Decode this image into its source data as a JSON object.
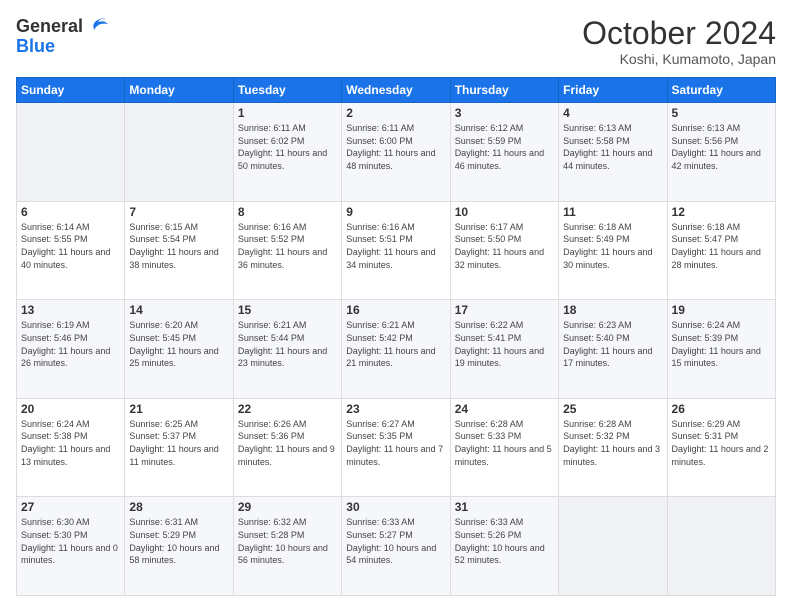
{
  "header": {
    "logo_line1": "General",
    "logo_line2": "Blue",
    "month_title": "October 2024",
    "location": "Koshi, Kumamoto, Japan"
  },
  "days_of_week": [
    "Sunday",
    "Monday",
    "Tuesday",
    "Wednesday",
    "Thursday",
    "Friday",
    "Saturday"
  ],
  "weeks": [
    [
      {
        "day": "",
        "content": ""
      },
      {
        "day": "",
        "content": ""
      },
      {
        "day": "1",
        "content": "Sunrise: 6:11 AM\nSunset: 6:02 PM\nDaylight: 11 hours and 50 minutes."
      },
      {
        "day": "2",
        "content": "Sunrise: 6:11 AM\nSunset: 6:00 PM\nDaylight: 11 hours and 48 minutes."
      },
      {
        "day": "3",
        "content": "Sunrise: 6:12 AM\nSunset: 5:59 PM\nDaylight: 11 hours and 46 minutes."
      },
      {
        "day": "4",
        "content": "Sunrise: 6:13 AM\nSunset: 5:58 PM\nDaylight: 11 hours and 44 minutes."
      },
      {
        "day": "5",
        "content": "Sunrise: 6:13 AM\nSunset: 5:56 PM\nDaylight: 11 hours and 42 minutes."
      }
    ],
    [
      {
        "day": "6",
        "content": "Sunrise: 6:14 AM\nSunset: 5:55 PM\nDaylight: 11 hours and 40 minutes."
      },
      {
        "day": "7",
        "content": "Sunrise: 6:15 AM\nSunset: 5:54 PM\nDaylight: 11 hours and 38 minutes."
      },
      {
        "day": "8",
        "content": "Sunrise: 6:16 AM\nSunset: 5:52 PM\nDaylight: 11 hours and 36 minutes."
      },
      {
        "day": "9",
        "content": "Sunrise: 6:16 AM\nSunset: 5:51 PM\nDaylight: 11 hours and 34 minutes."
      },
      {
        "day": "10",
        "content": "Sunrise: 6:17 AM\nSunset: 5:50 PM\nDaylight: 11 hours and 32 minutes."
      },
      {
        "day": "11",
        "content": "Sunrise: 6:18 AM\nSunset: 5:49 PM\nDaylight: 11 hours and 30 minutes."
      },
      {
        "day": "12",
        "content": "Sunrise: 6:18 AM\nSunset: 5:47 PM\nDaylight: 11 hours and 28 minutes."
      }
    ],
    [
      {
        "day": "13",
        "content": "Sunrise: 6:19 AM\nSunset: 5:46 PM\nDaylight: 11 hours and 26 minutes."
      },
      {
        "day": "14",
        "content": "Sunrise: 6:20 AM\nSunset: 5:45 PM\nDaylight: 11 hours and 25 minutes."
      },
      {
        "day": "15",
        "content": "Sunrise: 6:21 AM\nSunset: 5:44 PM\nDaylight: 11 hours and 23 minutes."
      },
      {
        "day": "16",
        "content": "Sunrise: 6:21 AM\nSunset: 5:42 PM\nDaylight: 11 hours and 21 minutes."
      },
      {
        "day": "17",
        "content": "Sunrise: 6:22 AM\nSunset: 5:41 PM\nDaylight: 11 hours and 19 minutes."
      },
      {
        "day": "18",
        "content": "Sunrise: 6:23 AM\nSunset: 5:40 PM\nDaylight: 11 hours and 17 minutes."
      },
      {
        "day": "19",
        "content": "Sunrise: 6:24 AM\nSunset: 5:39 PM\nDaylight: 11 hours and 15 minutes."
      }
    ],
    [
      {
        "day": "20",
        "content": "Sunrise: 6:24 AM\nSunset: 5:38 PM\nDaylight: 11 hours and 13 minutes."
      },
      {
        "day": "21",
        "content": "Sunrise: 6:25 AM\nSunset: 5:37 PM\nDaylight: 11 hours and 11 minutes."
      },
      {
        "day": "22",
        "content": "Sunrise: 6:26 AM\nSunset: 5:36 PM\nDaylight: 11 hours and 9 minutes."
      },
      {
        "day": "23",
        "content": "Sunrise: 6:27 AM\nSunset: 5:35 PM\nDaylight: 11 hours and 7 minutes."
      },
      {
        "day": "24",
        "content": "Sunrise: 6:28 AM\nSunset: 5:33 PM\nDaylight: 11 hours and 5 minutes."
      },
      {
        "day": "25",
        "content": "Sunrise: 6:28 AM\nSunset: 5:32 PM\nDaylight: 11 hours and 3 minutes."
      },
      {
        "day": "26",
        "content": "Sunrise: 6:29 AM\nSunset: 5:31 PM\nDaylight: 11 hours and 2 minutes."
      }
    ],
    [
      {
        "day": "27",
        "content": "Sunrise: 6:30 AM\nSunset: 5:30 PM\nDaylight: 11 hours and 0 minutes."
      },
      {
        "day": "28",
        "content": "Sunrise: 6:31 AM\nSunset: 5:29 PM\nDaylight: 10 hours and 58 minutes."
      },
      {
        "day": "29",
        "content": "Sunrise: 6:32 AM\nSunset: 5:28 PM\nDaylight: 10 hours and 56 minutes."
      },
      {
        "day": "30",
        "content": "Sunrise: 6:33 AM\nSunset: 5:27 PM\nDaylight: 10 hours and 54 minutes."
      },
      {
        "day": "31",
        "content": "Sunrise: 6:33 AM\nSunset: 5:26 PM\nDaylight: 10 hours and 52 minutes."
      },
      {
        "day": "",
        "content": ""
      },
      {
        "day": "",
        "content": ""
      }
    ]
  ]
}
